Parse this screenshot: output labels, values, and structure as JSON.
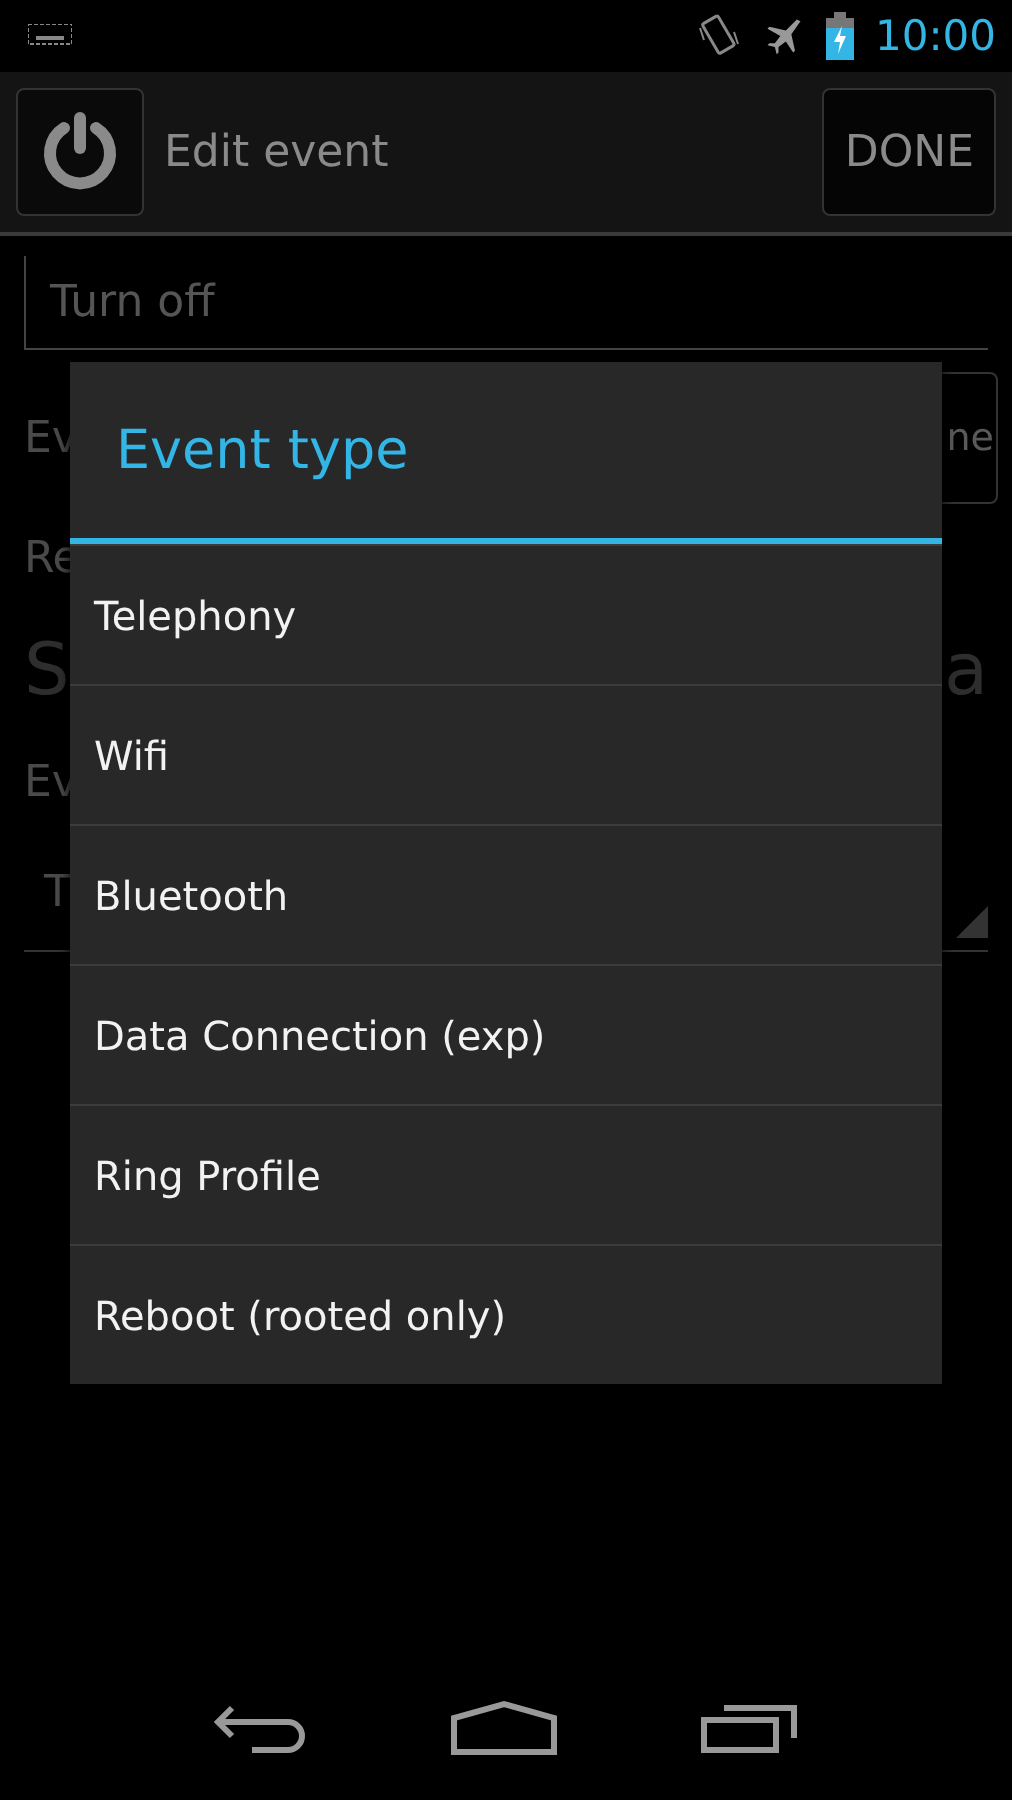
{
  "status_bar": {
    "time": "10:00"
  },
  "action_bar": {
    "title": "Edit event",
    "done_button": "DONE"
  },
  "form": {
    "name_field": {
      "value": "Turn off"
    },
    "rows": [
      {
        "kind": "button",
        "left": "Ev",
        "right": "ne"
      },
      {
        "kind": "label",
        "left": "Re"
      },
      {
        "kind": "big",
        "left": "S",
        "right": "a"
      },
      {
        "kind": "label",
        "left": "Ev"
      },
      {
        "kind": "spinner",
        "left": "T"
      }
    ]
  },
  "dialog": {
    "title": "Event type",
    "items": [
      {
        "label": "Telephony"
      },
      {
        "label": "Wifi"
      },
      {
        "label": "Bluetooth"
      },
      {
        "label": "Data Connection (exp)"
      },
      {
        "label": "Ring Profile"
      },
      {
        "label": "Reboot (rooted only)"
      }
    ]
  }
}
